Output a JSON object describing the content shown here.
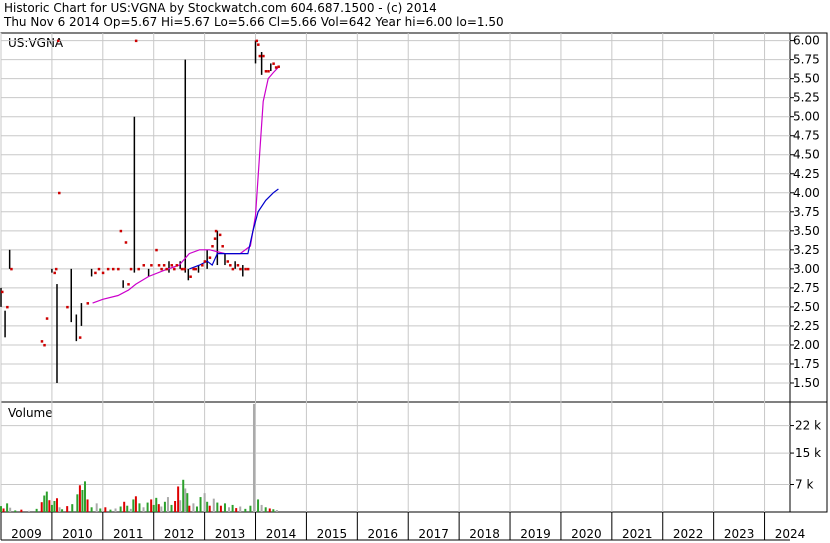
{
  "header": {
    "line1": "Historic Chart for US:VGNA by Stockwatch.com 604.687.1500 - (c) 2014",
    "line2": "Thu Nov  6 2014  Op=5.67  Hi=5.67  Lo=5.66  Cl=5.66  Vol=642  Year hi=6.00  lo=1.50"
  },
  "chart_data": [
    {
      "type": "line",
      "title": "US:VGNA",
      "ylim": [
        1.25,
        6.1
      ],
      "y_ticks": [
        "6.00",
        "5.75",
        "5.50",
        "5.25",
        "5.00",
        "4.75",
        "4.50",
        "4.25",
        "4.00",
        "3.75",
        "3.50",
        "3.25",
        "3.00",
        "2.75",
        "2.50",
        "2.25",
        "2.00",
        "1.75",
        "1.50"
      ],
      "grid": true,
      "colors": {
        "price": "#cc0000",
        "bar": "#000000",
        "ma_short": "#0000cc",
        "ma_long": "#cc00cc"
      },
      "price_bars": [
        {
          "x": 2009.0,
          "hi": 2.75,
          "lo": 2.5
        },
        {
          "x": 2009.08,
          "hi": 2.45,
          "lo": 2.1
        },
        {
          "x": 2009.17,
          "hi": 3.25,
          "lo": 3.0
        },
        {
          "x": 2010.0,
          "hi": 3.0,
          "lo": 2.95
        },
        {
          "x": 2010.1,
          "hi": 2.8,
          "lo": 1.5
        },
        {
          "x": 2010.38,
          "hi": 3.0,
          "lo": 2.3
        },
        {
          "x": 2010.48,
          "hi": 2.4,
          "lo": 2.05
        },
        {
          "x": 2010.58,
          "hi": 2.55,
          "lo": 2.25
        },
        {
          "x": 2010.78,
          "hi": 3.0,
          "lo": 2.9
        },
        {
          "x": 2011.4,
          "hi": 2.85,
          "lo": 2.75
        },
        {
          "x": 2011.62,
          "hi": 5.0,
          "lo": 2.95
        },
        {
          "x": 2011.9,
          "hi": 3.0,
          "lo": 2.9
        },
        {
          "x": 2012.3,
          "hi": 3.1,
          "lo": 2.95
        },
        {
          "x": 2012.52,
          "hi": 3.1,
          "lo": 3.0
        },
        {
          "x": 2012.62,
          "hi": 5.75,
          "lo": 2.95
        },
        {
          "x": 2012.68,
          "hi": 3.0,
          "lo": 2.85
        },
        {
          "x": 2012.88,
          "hi": 3.05,
          "lo": 2.95
        },
        {
          "x": 2013.05,
          "hi": 3.25,
          "lo": 3.0
        },
        {
          "x": 2013.25,
          "hi": 3.5,
          "lo": 3.05
        },
        {
          "x": 2013.4,
          "hi": 3.2,
          "lo": 3.05
        },
        {
          "x": 2013.6,
          "hi": 3.1,
          "lo": 3.0
        },
        {
          "x": 2013.75,
          "hi": 3.05,
          "lo": 2.9
        },
        {
          "x": 2014.0,
          "hi": 6.0,
          "lo": 5.7
        },
        {
          "x": 2014.12,
          "hi": 5.85,
          "lo": 5.55
        },
        {
          "x": 2014.3,
          "hi": 5.7,
          "lo": 5.6
        }
      ],
      "price_dots": [
        {
          "x": 2009.02,
          "y": 2.7
        },
        {
          "x": 2009.12,
          "y": 2.5
        },
        {
          "x": 2009.2,
          "y": 3.0
        },
        {
          "x": 2009.8,
          "y": 2.05
        },
        {
          "x": 2009.85,
          "y": 2.0
        },
        {
          "x": 2009.9,
          "y": 2.35
        },
        {
          "x": 2010.05,
          "y": 2.95
        },
        {
          "x": 2010.08,
          "y": 3.0
        },
        {
          "x": 2010.12,
          "y": 6.0
        },
        {
          "x": 2010.14,
          "y": 4.0
        },
        {
          "x": 2010.3,
          "y": 2.5
        },
        {
          "x": 2010.55,
          "y": 2.1
        },
        {
          "x": 2010.7,
          "y": 2.55
        },
        {
          "x": 2010.85,
          "y": 2.95
        },
        {
          "x": 2010.92,
          "y": 3.0
        },
        {
          "x": 2011.0,
          "y": 2.95
        },
        {
          "x": 2011.1,
          "y": 3.0
        },
        {
          "x": 2011.2,
          "y": 3.0
        },
        {
          "x": 2011.3,
          "y": 3.0
        },
        {
          "x": 2011.35,
          "y": 3.5
        },
        {
          "x": 2011.45,
          "y": 3.35
        },
        {
          "x": 2011.55,
          "y": 3.0
        },
        {
          "x": 2011.5,
          "y": 2.8
        },
        {
          "x": 2011.65,
          "y": 6.0
        },
        {
          "x": 2011.7,
          "y": 3.0
        },
        {
          "x": 2011.8,
          "y": 3.05
        },
        {
          "x": 2011.95,
          "y": 3.05
        },
        {
          "x": 2012.05,
          "y": 3.25
        },
        {
          "x": 2012.1,
          "y": 3.05
        },
        {
          "x": 2012.15,
          "y": 3.0
        },
        {
          "x": 2012.2,
          "y": 3.05
        },
        {
          "x": 2012.25,
          "y": 3.0
        },
        {
          "x": 2012.35,
          "y": 3.05
        },
        {
          "x": 2012.4,
          "y": 3.0
        },
        {
          "x": 2012.45,
          "y": 3.05
        },
        {
          "x": 2012.55,
          "y": 3.0
        },
        {
          "x": 2012.6,
          "y": 3.0
        },
        {
          "x": 2012.72,
          "y": 2.9
        },
        {
          "x": 2012.78,
          "y": 3.0
        },
        {
          "x": 2012.82,
          "y": 3.0
        },
        {
          "x": 2012.95,
          "y": 3.05
        },
        {
          "x": 2013.0,
          "y": 3.1
        },
        {
          "x": 2013.1,
          "y": 3.15
        },
        {
          "x": 2013.15,
          "y": 3.3
        },
        {
          "x": 2013.2,
          "y": 3.4
        },
        {
          "x": 2013.22,
          "y": 3.5
        },
        {
          "x": 2013.3,
          "y": 3.45
        },
        {
          "x": 2013.35,
          "y": 3.3
        },
        {
          "x": 2013.45,
          "y": 3.1
        },
        {
          "x": 2013.5,
          "y": 3.05
        },
        {
          "x": 2013.55,
          "y": 3.0
        },
        {
          "x": 2013.65,
          "y": 3.05
        },
        {
          "x": 2013.7,
          "y": 3.0
        },
        {
          "x": 2013.8,
          "y": 3.0
        },
        {
          "x": 2013.85,
          "y": 3.0
        },
        {
          "x": 2014.02,
          "y": 6.0
        },
        {
          "x": 2014.05,
          "y": 5.95
        },
        {
          "x": 2014.08,
          "y": 5.8
        },
        {
          "x": 2014.15,
          "y": 5.8
        },
        {
          "x": 2014.2,
          "y": 5.6
        },
        {
          "x": 2014.25,
          "y": 5.6
        },
        {
          "x": 2014.35,
          "y": 5.7
        },
        {
          "x": 2014.4,
          "y": 5.65
        },
        {
          "x": 2014.45,
          "y": 5.66
        }
      ],
      "ma_short": [
        {
          "x": 2012.7,
          "y": 3.0
        },
        {
          "x": 2012.9,
          "y": 3.05
        },
        {
          "x": 2013.05,
          "y": 3.1
        },
        {
          "x": 2013.15,
          "y": 3.05
        },
        {
          "x": 2013.25,
          "y": 3.2
        },
        {
          "x": 2013.4,
          "y": 3.2
        },
        {
          "x": 2013.6,
          "y": 3.2
        },
        {
          "x": 2013.85,
          "y": 3.2
        },
        {
          "x": 2013.95,
          "y": 3.5
        },
        {
          "x": 2014.05,
          "y": 3.75
        },
        {
          "x": 2014.2,
          "y": 3.9
        },
        {
          "x": 2014.35,
          "y": 4.0
        },
        {
          "x": 2014.45,
          "y": 4.05
        }
      ],
      "ma_long": [
        {
          "x": 2010.8,
          "y": 2.55
        },
        {
          "x": 2011.0,
          "y": 2.6
        },
        {
          "x": 2011.3,
          "y": 2.65
        },
        {
          "x": 2011.5,
          "y": 2.72
        },
        {
          "x": 2011.65,
          "y": 2.8
        },
        {
          "x": 2011.9,
          "y": 2.9
        },
        {
          "x": 2012.2,
          "y": 2.98
        },
        {
          "x": 2012.5,
          "y": 3.05
        },
        {
          "x": 2012.7,
          "y": 3.2
        },
        {
          "x": 2012.9,
          "y": 3.25
        },
        {
          "x": 2013.1,
          "y": 3.25
        },
        {
          "x": 2013.4,
          "y": 3.2
        },
        {
          "x": 2013.7,
          "y": 3.2
        },
        {
          "x": 2013.9,
          "y": 3.3
        },
        {
          "x": 2014.0,
          "y": 3.7
        },
        {
          "x": 2014.08,
          "y": 4.5
        },
        {
          "x": 2014.15,
          "y": 5.2
        },
        {
          "x": 2014.25,
          "y": 5.5
        },
        {
          "x": 2014.35,
          "y": 5.58
        },
        {
          "x": 2014.45,
          "y": 5.65
        }
      ]
    },
    {
      "type": "bar",
      "title": "Volume",
      "ylim": [
        0,
        28000
      ],
      "y_ticks": [
        {
          "v": 22000,
          "label": "22 k"
        },
        {
          "v": 15000,
          "label": "15 k"
        },
        {
          "v": 7000,
          "label": "7 k"
        }
      ],
      "grid": true,
      "colors": {
        "up": "#2ca02c",
        "down": "#dd0000",
        "flat": "#aaaaaa"
      },
      "bars": [
        {
          "x": 2009.0,
          "v": 1500,
          "c": "up"
        },
        {
          "x": 2009.05,
          "v": 900,
          "c": "down"
        },
        {
          "x": 2009.12,
          "v": 2200,
          "c": "up"
        },
        {
          "x": 2009.18,
          "v": 1100,
          "c": "flat"
        },
        {
          "x": 2009.28,
          "v": 400,
          "c": "up"
        },
        {
          "x": 2009.4,
          "v": 600,
          "c": "down"
        },
        {
          "x": 2009.55,
          "v": 300,
          "c": "flat"
        },
        {
          "x": 2009.7,
          "v": 800,
          "c": "up"
        },
        {
          "x": 2009.8,
          "v": 2500,
          "c": "down"
        },
        {
          "x": 2009.85,
          "v": 4200,
          "c": "up"
        },
        {
          "x": 2009.9,
          "v": 5200,
          "c": "up"
        },
        {
          "x": 2009.95,
          "v": 3000,
          "c": "down"
        },
        {
          "x": 2010.0,
          "v": 1800,
          "c": "up"
        },
        {
          "x": 2010.05,
          "v": 2800,
          "c": "up"
        },
        {
          "x": 2010.1,
          "v": 3500,
          "c": "down"
        },
        {
          "x": 2010.15,
          "v": 1200,
          "c": "flat"
        },
        {
          "x": 2010.2,
          "v": 700,
          "c": "up"
        },
        {
          "x": 2010.3,
          "v": 1500,
          "c": "down"
        },
        {
          "x": 2010.4,
          "v": 2000,
          "c": "up"
        },
        {
          "x": 2010.5,
          "v": 4500,
          "c": "up"
        },
        {
          "x": 2010.55,
          "v": 6800,
          "c": "down"
        },
        {
          "x": 2010.6,
          "v": 5600,
          "c": "up"
        },
        {
          "x": 2010.65,
          "v": 7800,
          "c": "up"
        },
        {
          "x": 2010.7,
          "v": 3200,
          "c": "down"
        },
        {
          "x": 2010.78,
          "v": 1200,
          "c": "up"
        },
        {
          "x": 2010.88,
          "v": 2200,
          "c": "flat"
        },
        {
          "x": 2010.95,
          "v": 900,
          "c": "up"
        },
        {
          "x": 2011.05,
          "v": 1200,
          "c": "down"
        },
        {
          "x": 2011.15,
          "v": 600,
          "c": "up"
        },
        {
          "x": 2011.25,
          "v": 900,
          "c": "flat"
        },
        {
          "x": 2011.35,
          "v": 1400,
          "c": "up"
        },
        {
          "x": 2011.42,
          "v": 2600,
          "c": "down"
        },
        {
          "x": 2011.48,
          "v": 1600,
          "c": "up"
        },
        {
          "x": 2011.55,
          "v": 800,
          "c": "flat"
        },
        {
          "x": 2011.6,
          "v": 3200,
          "c": "up"
        },
        {
          "x": 2011.65,
          "v": 4000,
          "c": "down"
        },
        {
          "x": 2011.72,
          "v": 2200,
          "c": "up"
        },
        {
          "x": 2011.8,
          "v": 1200,
          "c": "flat"
        },
        {
          "x": 2011.88,
          "v": 2400,
          "c": "up"
        },
        {
          "x": 2011.95,
          "v": 3200,
          "c": "down"
        },
        {
          "x": 2012.0,
          "v": 1800,
          "c": "up"
        },
        {
          "x": 2012.05,
          "v": 3600,
          "c": "up"
        },
        {
          "x": 2012.1,
          "v": 2000,
          "c": "down"
        },
        {
          "x": 2012.15,
          "v": 1400,
          "c": "flat"
        },
        {
          "x": 2012.22,
          "v": 2600,
          "c": "up"
        },
        {
          "x": 2012.28,
          "v": 3800,
          "c": "flat"
        },
        {
          "x": 2012.35,
          "v": 1800,
          "c": "up"
        },
        {
          "x": 2012.42,
          "v": 2800,
          "c": "down"
        },
        {
          "x": 2012.48,
          "v": 6500,
          "c": "down"
        },
        {
          "x": 2012.52,
          "v": 3000,
          "c": "flat"
        },
        {
          "x": 2012.58,
          "v": 8200,
          "c": "up"
        },
        {
          "x": 2012.62,
          "v": 6000,
          "c": "flat"
        },
        {
          "x": 2012.66,
          "v": 4800,
          "c": "up"
        },
        {
          "x": 2012.7,
          "v": 1600,
          "c": "down"
        },
        {
          "x": 2012.78,
          "v": 2200,
          "c": "flat"
        },
        {
          "x": 2012.85,
          "v": 1400,
          "c": "up"
        },
        {
          "x": 2012.92,
          "v": 3800,
          "c": "up"
        },
        {
          "x": 2013.0,
          "v": 4800,
          "c": "flat"
        },
        {
          "x": 2013.05,
          "v": 2600,
          "c": "up"
        },
        {
          "x": 2013.1,
          "v": 1600,
          "c": "down"
        },
        {
          "x": 2013.18,
          "v": 3400,
          "c": "flat"
        },
        {
          "x": 2013.25,
          "v": 2400,
          "c": "up"
        },
        {
          "x": 2013.32,
          "v": 1600,
          "c": "down"
        },
        {
          "x": 2013.4,
          "v": 2200,
          "c": "up"
        },
        {
          "x": 2013.48,
          "v": 1200,
          "c": "flat"
        },
        {
          "x": 2013.55,
          "v": 1800,
          "c": "up"
        },
        {
          "x": 2013.62,
          "v": 1000,
          "c": "down"
        },
        {
          "x": 2013.7,
          "v": 1400,
          "c": "flat"
        },
        {
          "x": 2013.8,
          "v": 800,
          "c": "up"
        },
        {
          "x": 2013.9,
          "v": 1600,
          "c": "up"
        },
        {
          "x": 2013.97,
          "v": 27500,
          "c": "flat"
        },
        {
          "x": 2014.05,
          "v": 3200,
          "c": "up"
        },
        {
          "x": 2014.12,
          "v": 1800,
          "c": "flat"
        },
        {
          "x": 2014.2,
          "v": 1200,
          "c": "up"
        },
        {
          "x": 2014.28,
          "v": 900,
          "c": "down"
        },
        {
          "x": 2014.35,
          "v": 700,
          "c": "up"
        },
        {
          "x": 2014.42,
          "v": 500,
          "c": "flat"
        }
      ]
    }
  ],
  "x_axis": {
    "min": 2009.0,
    "max": 2024.5,
    "labels": [
      "2009",
      "2010",
      "2011",
      "2012",
      "2013",
      "2014",
      "2015",
      "2016",
      "2017",
      "2018",
      "2019",
      "2020",
      "2021",
      "2022",
      "2023",
      "2024"
    ]
  }
}
